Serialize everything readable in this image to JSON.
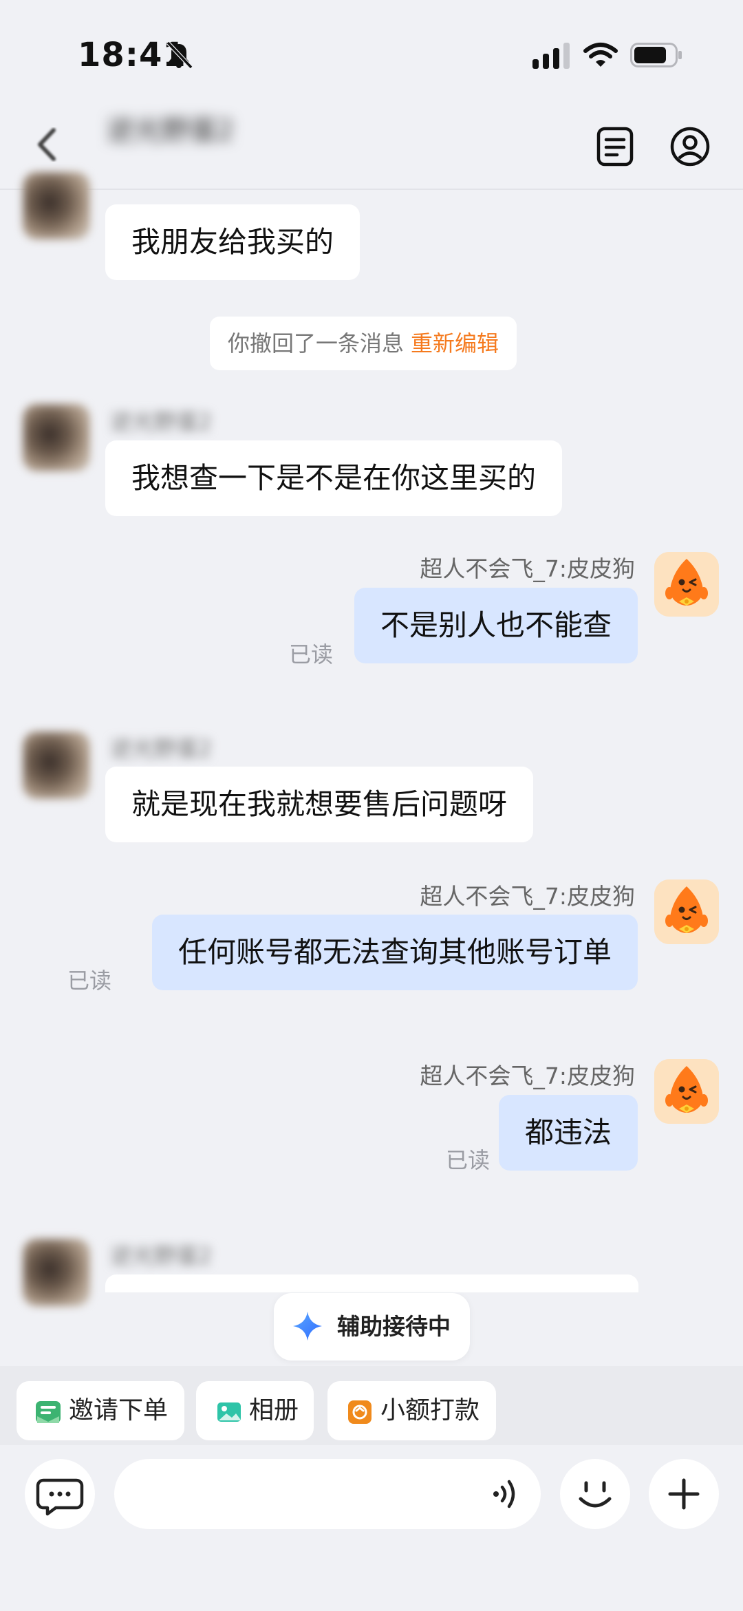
{
  "status_bar": {
    "time": "18:41"
  },
  "header": {
    "contact_name": "逆光野蛋2"
  },
  "messages": [
    {
      "type": "incoming",
      "sender": "逆光野蛋2",
      "text": "我朋友给我买的"
    },
    {
      "type": "system",
      "text": "你撤回了一条消息",
      "action": "重新编辑"
    },
    {
      "type": "incoming",
      "sender": "逆光野蛋2",
      "text": "我想查一下是不是在你这里买的"
    },
    {
      "type": "outgoing",
      "sender": "超人不会飞_7:皮皮狗",
      "text": "不是别人也不能查",
      "status": "已读"
    },
    {
      "type": "incoming",
      "sender": "逆光野蛋2",
      "text": "就是现在我就想要售后问题呀"
    },
    {
      "type": "outgoing",
      "sender": "超人不会飞_7:皮皮狗",
      "text": "任何账号都无法查询其他账号订单",
      "status": "已读"
    },
    {
      "type": "outgoing",
      "sender": "超人不会飞_7:皮皮狗",
      "text": "都违法",
      "status": "已读"
    },
    {
      "type": "incoming",
      "sender": "逆光野蛋2",
      "text": ""
    }
  ],
  "assist": {
    "label": "辅助接待中"
  },
  "quick_actions": [
    {
      "label": "邀请下单",
      "icon": "invite-order-icon",
      "color": "#3cb371"
    },
    {
      "label": "相册",
      "icon": "album-icon",
      "color": "#2ec4a8"
    },
    {
      "label": "小额打款",
      "icon": "small-payment-icon",
      "color": "#f08a1c"
    }
  ],
  "input": {
    "placeholder": ""
  },
  "colors": {
    "outgoing_bubble": "#d8e6ff",
    "incoming_bubble": "#ffffff",
    "accent_orange": "#f57a1e",
    "background": "#f0f1f5"
  }
}
